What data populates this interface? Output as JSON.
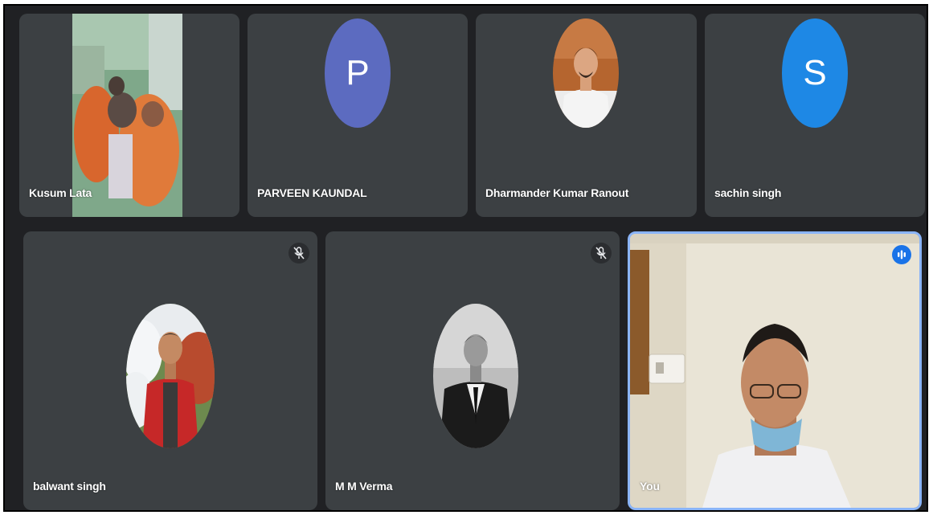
{
  "participants_top": [
    {
      "name": "Kusum Lata",
      "type": "video"
    },
    {
      "name": "PARVEEN KAUNDAL",
      "type": "initial",
      "initial": "P",
      "color": "#5c6bc0"
    },
    {
      "name": "Dharmander Kumar Ranout",
      "type": "photo"
    },
    {
      "name": "sachin singh",
      "type": "initial",
      "initial": "S",
      "color": "#1e88e5"
    }
  ],
  "participants_bottom": [
    {
      "name": "balwant singh",
      "type": "photo",
      "muted": true
    },
    {
      "name": "M M Verma",
      "type": "photo",
      "muted": true
    },
    {
      "name": "You",
      "type": "video",
      "speaking": true
    }
  ],
  "colors": {
    "background": "#202124",
    "tile": "#3c4043",
    "active_border": "#8ab4f8",
    "speaking_indicator": "#1a73e8"
  },
  "icons": {
    "muted": "mic-off-icon",
    "speaking": "audio-level-icon"
  }
}
